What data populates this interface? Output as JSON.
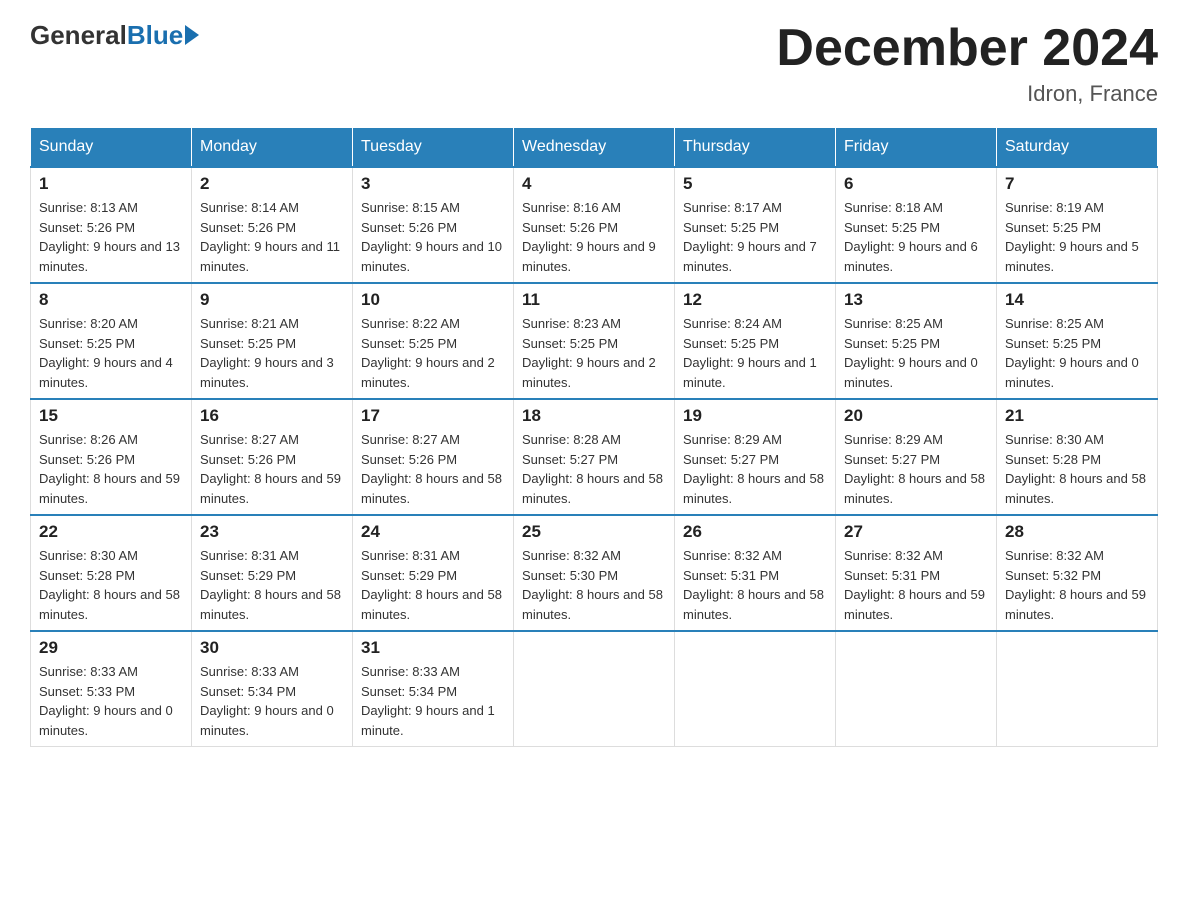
{
  "header": {
    "logo_general": "General",
    "logo_blue": "Blue",
    "month_title": "December 2024",
    "location": "Idron, France"
  },
  "days_of_week": [
    "Sunday",
    "Monday",
    "Tuesday",
    "Wednesday",
    "Thursday",
    "Friday",
    "Saturday"
  ],
  "weeks": [
    [
      {
        "day": "1",
        "sunrise": "8:13 AM",
        "sunset": "5:26 PM",
        "daylight": "9 hours and 13 minutes."
      },
      {
        "day": "2",
        "sunrise": "8:14 AM",
        "sunset": "5:26 PM",
        "daylight": "9 hours and 11 minutes."
      },
      {
        "day": "3",
        "sunrise": "8:15 AM",
        "sunset": "5:26 PM",
        "daylight": "9 hours and 10 minutes."
      },
      {
        "day": "4",
        "sunrise": "8:16 AM",
        "sunset": "5:26 PM",
        "daylight": "9 hours and 9 minutes."
      },
      {
        "day": "5",
        "sunrise": "8:17 AM",
        "sunset": "5:25 PM",
        "daylight": "9 hours and 7 minutes."
      },
      {
        "day": "6",
        "sunrise": "8:18 AM",
        "sunset": "5:25 PM",
        "daylight": "9 hours and 6 minutes."
      },
      {
        "day": "7",
        "sunrise": "8:19 AM",
        "sunset": "5:25 PM",
        "daylight": "9 hours and 5 minutes."
      }
    ],
    [
      {
        "day": "8",
        "sunrise": "8:20 AM",
        "sunset": "5:25 PM",
        "daylight": "9 hours and 4 minutes."
      },
      {
        "day": "9",
        "sunrise": "8:21 AM",
        "sunset": "5:25 PM",
        "daylight": "9 hours and 3 minutes."
      },
      {
        "day": "10",
        "sunrise": "8:22 AM",
        "sunset": "5:25 PM",
        "daylight": "9 hours and 2 minutes."
      },
      {
        "day": "11",
        "sunrise": "8:23 AM",
        "sunset": "5:25 PM",
        "daylight": "9 hours and 2 minutes."
      },
      {
        "day": "12",
        "sunrise": "8:24 AM",
        "sunset": "5:25 PM",
        "daylight": "9 hours and 1 minute."
      },
      {
        "day": "13",
        "sunrise": "8:25 AM",
        "sunset": "5:25 PM",
        "daylight": "9 hours and 0 minutes."
      },
      {
        "day": "14",
        "sunrise": "8:25 AM",
        "sunset": "5:25 PM",
        "daylight": "9 hours and 0 minutes."
      }
    ],
    [
      {
        "day": "15",
        "sunrise": "8:26 AM",
        "sunset": "5:26 PM",
        "daylight": "8 hours and 59 minutes."
      },
      {
        "day": "16",
        "sunrise": "8:27 AM",
        "sunset": "5:26 PM",
        "daylight": "8 hours and 59 minutes."
      },
      {
        "day": "17",
        "sunrise": "8:27 AM",
        "sunset": "5:26 PM",
        "daylight": "8 hours and 58 minutes."
      },
      {
        "day": "18",
        "sunrise": "8:28 AM",
        "sunset": "5:27 PM",
        "daylight": "8 hours and 58 minutes."
      },
      {
        "day": "19",
        "sunrise": "8:29 AM",
        "sunset": "5:27 PM",
        "daylight": "8 hours and 58 minutes."
      },
      {
        "day": "20",
        "sunrise": "8:29 AM",
        "sunset": "5:27 PM",
        "daylight": "8 hours and 58 minutes."
      },
      {
        "day": "21",
        "sunrise": "8:30 AM",
        "sunset": "5:28 PM",
        "daylight": "8 hours and 58 minutes."
      }
    ],
    [
      {
        "day": "22",
        "sunrise": "8:30 AM",
        "sunset": "5:28 PM",
        "daylight": "8 hours and 58 minutes."
      },
      {
        "day": "23",
        "sunrise": "8:31 AM",
        "sunset": "5:29 PM",
        "daylight": "8 hours and 58 minutes."
      },
      {
        "day": "24",
        "sunrise": "8:31 AM",
        "sunset": "5:29 PM",
        "daylight": "8 hours and 58 minutes."
      },
      {
        "day": "25",
        "sunrise": "8:32 AM",
        "sunset": "5:30 PM",
        "daylight": "8 hours and 58 minutes."
      },
      {
        "day": "26",
        "sunrise": "8:32 AM",
        "sunset": "5:31 PM",
        "daylight": "8 hours and 58 minutes."
      },
      {
        "day": "27",
        "sunrise": "8:32 AM",
        "sunset": "5:31 PM",
        "daylight": "8 hours and 59 minutes."
      },
      {
        "day": "28",
        "sunrise": "8:32 AM",
        "sunset": "5:32 PM",
        "daylight": "8 hours and 59 minutes."
      }
    ],
    [
      {
        "day": "29",
        "sunrise": "8:33 AM",
        "sunset": "5:33 PM",
        "daylight": "9 hours and 0 minutes."
      },
      {
        "day": "30",
        "sunrise": "8:33 AM",
        "sunset": "5:34 PM",
        "daylight": "9 hours and 0 minutes."
      },
      {
        "day": "31",
        "sunrise": "8:33 AM",
        "sunset": "5:34 PM",
        "daylight": "9 hours and 1 minute."
      },
      null,
      null,
      null,
      null
    ]
  ],
  "labels": {
    "sunrise": "Sunrise:",
    "sunset": "Sunset:",
    "daylight": "Daylight:"
  }
}
